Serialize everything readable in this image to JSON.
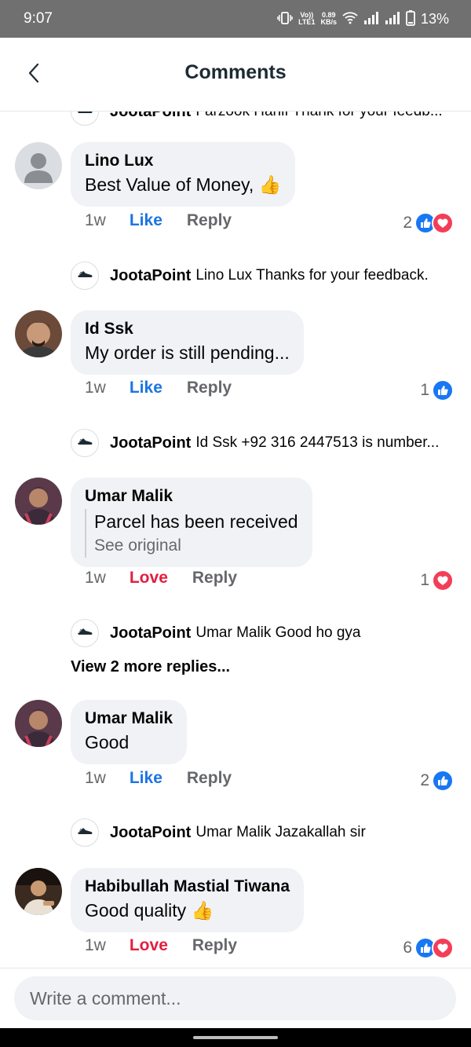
{
  "status_bar": {
    "time": "9:07",
    "network_type": "LTE1",
    "speed": "0.89",
    "speed_unit": "KB/s",
    "battery": "13%"
  },
  "header": {
    "title": "Comments"
  },
  "truncated_top_reply": {
    "page_name": "JootaPoint",
    "text": "Farzook Hanif Thank for your feedb..."
  },
  "comments": [
    {
      "author": "Lino Lux",
      "text": "Best Value of Money, 👍",
      "time": "1w",
      "reaction_label": "Like",
      "reply_label": "Reply",
      "reaction_count": "2",
      "reactions": [
        "like",
        "love"
      ],
      "page_reply": {
        "page_name": "JootaPoint",
        "text": "Lino Lux Thanks for your feedback."
      }
    },
    {
      "author": "Id Ssk",
      "text": "My order is still pending...",
      "time": "1w",
      "reaction_label": "Like",
      "reply_label": "Reply",
      "reaction_count": "1",
      "reactions": [
        "like"
      ],
      "page_reply": {
        "page_name": "JootaPoint",
        "text": "Id Ssk +92 316 2447513 is number..."
      }
    },
    {
      "author": "Umar Malik",
      "text": "Parcel has been received",
      "see_original": "See original",
      "time": "1w",
      "reaction_label": "Love",
      "reply_label": "Reply",
      "reaction_count": "1",
      "reactions": [
        "love"
      ],
      "page_reply": {
        "page_name": "JootaPoint",
        "text": "Umar Malik Good ho gya"
      },
      "more_replies": "View 2 more replies..."
    },
    {
      "author": "Umar Malik",
      "text": "Good",
      "time": "1w",
      "reaction_label": "Like",
      "reply_label": "Reply",
      "reaction_count": "2",
      "reactions": [
        "like"
      ],
      "page_reply": {
        "page_name": "JootaPoint",
        "text": "Umar Malik Jazakallah sir"
      }
    },
    {
      "author": "Habibullah Mastial Tiwana",
      "text": "Good quality 👍",
      "time": "1w",
      "reaction_label": "Love",
      "reply_label": "Reply",
      "reaction_count": "6",
      "reactions": [
        "like",
        "love"
      ]
    }
  ],
  "composer": {
    "placeholder": "Write a comment..."
  },
  "colors": {
    "like_blue": "#1b74e4",
    "love_red": "#e41e3f",
    "bubble_bg": "#f0f2f5",
    "muted_text": "#65676b",
    "status_bar_bg": "#707070"
  },
  "icons": {
    "back": "chevron-left-icon",
    "like": "thumbs-up-icon",
    "love": "heart-icon",
    "page_logo": "shoe-logo-icon"
  }
}
